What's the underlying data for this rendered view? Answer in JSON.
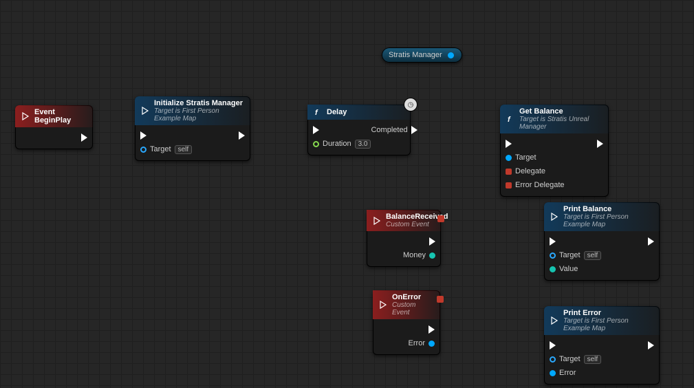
{
  "variable": {
    "name": "Stratis Manager"
  },
  "nodes": {
    "beginPlay": {
      "title": "Event BeginPlay"
    },
    "init": {
      "title": "Initialize Stratis Manager",
      "subtitle": "Target is First Person Example Map",
      "target": "Target",
      "self": "self"
    },
    "delay": {
      "title": "Delay",
      "duration_label": "Duration",
      "duration_value": "3.0",
      "completed": "Completed"
    },
    "getBalance": {
      "title": "Get Balance",
      "subtitle": "Target is Stratis Unreal Manager",
      "target": "Target",
      "delegate": "Delegate",
      "errorDelegate": "Error Delegate"
    },
    "balanceReceived": {
      "title": "BalanceReceived",
      "subtitle": "Custom Event",
      "money": "Money"
    },
    "onError": {
      "title": "OnError",
      "subtitle": "Custom Event",
      "error": "Error"
    },
    "printBalance": {
      "title": "Print Balance",
      "subtitle": "Target is First Person Example Map",
      "target": "Target",
      "self": "self",
      "value": "Value"
    },
    "printError": {
      "title": "Print Error",
      "subtitle": "Target is First Person Example Map",
      "target": "Target",
      "self": "self",
      "error": "Error"
    }
  }
}
